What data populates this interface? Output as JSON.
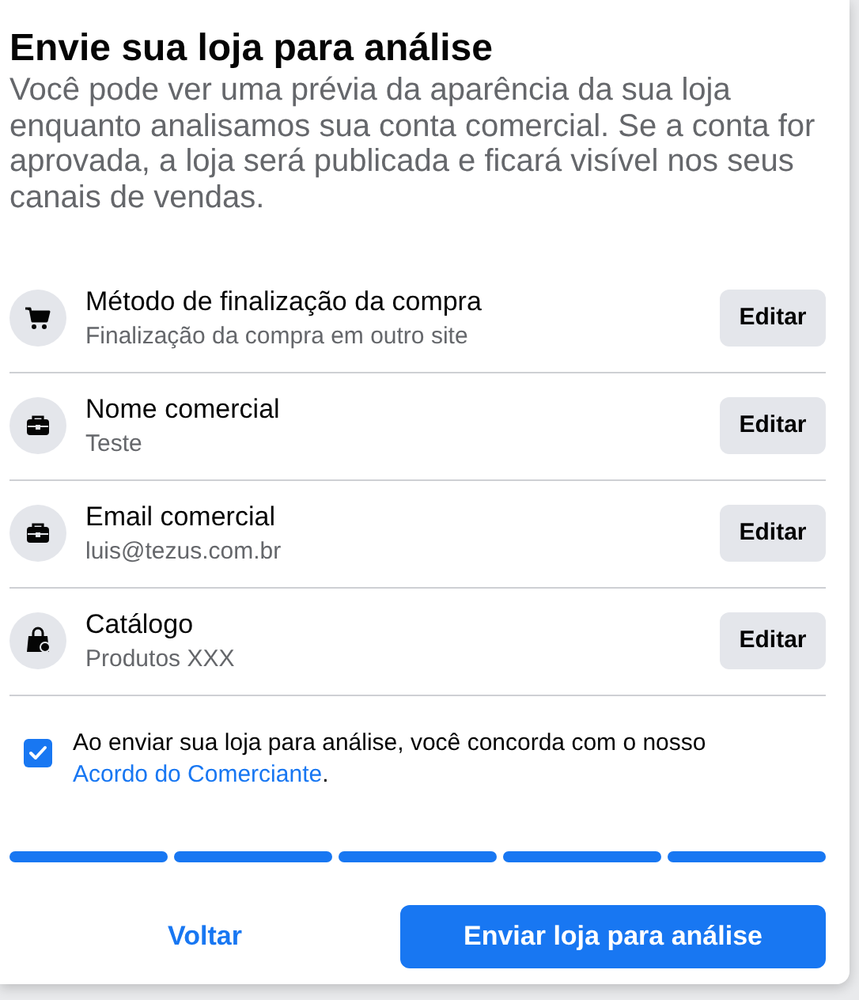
{
  "dialog": {
    "title": "Envie sua loja para análise",
    "description": "Você pode ver uma prévia da aparência da sua loja enquanto analisamos sua conta comercial. Se a conta for aprovada, a loja será publicada e ficará visível nos seus canais de vendas.",
    "items": [
      {
        "kind": "cart",
        "label": "Método de finalização da compra",
        "value": "Finalização da compra em outro site",
        "button": "Editar"
      },
      {
        "kind": "briefcase",
        "label": "Nome comercial",
        "value": "Teste",
        "button": "Editar"
      },
      {
        "kind": "briefcase",
        "label": "Email comercial",
        "value": "luis@tezus.com.br",
        "button": "Editar"
      },
      {
        "kind": "bag",
        "label": "Catálogo",
        "value": "Produtos XXX",
        "button": "Editar"
      }
    ],
    "agreement": {
      "checked": true,
      "text": "Ao enviar sua loja para análise, você concorda com o nosso",
      "link": "Acordo do Comerciante",
      "end": "."
    },
    "steps": [
      {
        "completed": true
      },
      {
        "completed": true
      },
      {
        "completed": true
      },
      {
        "completed": true
      },
      {
        "completed": true
      }
    ],
    "buttons": {
      "back": "Voltar",
      "submit": "Enviar loja para análise"
    }
  }
}
